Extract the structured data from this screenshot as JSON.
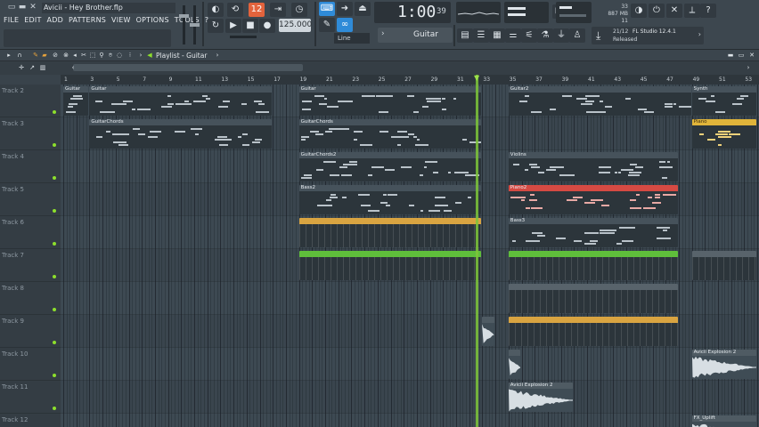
{
  "window": {
    "title": "Avicii - Hey Brother.flp",
    "buttons": [
      "▭",
      "▬",
      "✕"
    ]
  },
  "menu": [
    "FILE",
    "EDIT",
    "ADD",
    "PATTERNS",
    "VIEW",
    "OPTIONS",
    "TOOLS",
    "?"
  ],
  "transport": {
    "pattern_number": "12",
    "bpm": "125.000",
    "time_main": "1:00",
    "time_sub": "39",
    "snap": "Line",
    "pattern_name": "Guitar"
  },
  "cpu": {
    "value": "33",
    "memory": "887 MB",
    "polyphony": "11"
  },
  "news": {
    "date": "21/12",
    "title": "FL Studio 12.4.1",
    "status": "Released"
  },
  "playlist": {
    "title": "Playlist - Guitar",
    "breadcrumb_arrow": "›"
  },
  "ruler": {
    "bars": [
      "1",
      "3",
      "5",
      "7",
      "9",
      "11",
      "13",
      "15",
      "17",
      "19",
      "21",
      "23",
      "25",
      "27",
      "29",
      "31",
      "33",
      "35",
      "37",
      "39",
      "41",
      "43",
      "45",
      "47",
      "49",
      "51",
      "53"
    ]
  },
  "tracks": [
    {
      "name": "Track 2"
    },
    {
      "name": "Track 3"
    },
    {
      "name": "Track 4"
    },
    {
      "name": "Track 5"
    },
    {
      "name": "Track 6"
    },
    {
      "name": "Track 7"
    },
    {
      "name": "Track 8"
    },
    {
      "name": "Track 9"
    },
    {
      "name": "Track 10"
    },
    {
      "name": "Track 11"
    },
    {
      "name": "Track 12"
    }
  ],
  "playhead_bar": 32.5,
  "clips": [
    {
      "track": 0,
      "start": 1,
      "len": 2,
      "name": "Guitar",
      "kind": "pat"
    },
    {
      "track": 0,
      "start": 3,
      "len": 14,
      "name": "Guitar",
      "kind": "pat"
    },
    {
      "track": 0,
      "start": 19,
      "len": 14,
      "name": "Guitar",
      "kind": "pat"
    },
    {
      "track": 0,
      "start": 35,
      "len": 14,
      "name": "Guitar2",
      "kind": "pat"
    },
    {
      "track": 0,
      "start": 49,
      "len": 5,
      "name": "Synth",
      "kind": "pat"
    },
    {
      "track": 1,
      "start": 3,
      "len": 14,
      "name": "GuitarChords",
      "kind": "pat"
    },
    {
      "track": 1,
      "start": 19,
      "len": 14,
      "name": "GuitarChords",
      "kind": "pat"
    },
    {
      "track": 1,
      "start": 49,
      "len": 5,
      "name": "Piano",
      "kind": "yellow"
    },
    {
      "track": 2,
      "start": 19,
      "len": 14,
      "name": "GuitarChords2",
      "kind": "pat"
    },
    {
      "track": 2,
      "start": 35,
      "len": 13,
      "name": "Violins",
      "kind": "pat"
    },
    {
      "track": 3,
      "start": 19,
      "len": 14,
      "name": "Bass2",
      "kind": "pat"
    },
    {
      "track": 3,
      "start": 35,
      "len": 13,
      "name": "Piano2",
      "kind": "red"
    },
    {
      "track": 4,
      "start": 19,
      "len": 14,
      "name": "",
      "kind": "orange"
    },
    {
      "track": 4,
      "start": 35,
      "len": 13,
      "name": "Bass3",
      "kind": "pat"
    },
    {
      "track": 5,
      "start": 19,
      "len": 14,
      "name": "",
      "kind": "green"
    },
    {
      "track": 5,
      "start": 35,
      "len": 13,
      "name": "",
      "kind": "green"
    },
    {
      "track": 5,
      "start": 49,
      "len": 5,
      "name": "",
      "kind": "gray"
    },
    {
      "track": 6,
      "start": 35,
      "len": 13,
      "name": "",
      "kind": "gray"
    },
    {
      "track": 7,
      "start": 33,
      "len": 1,
      "name": "",
      "kind": "audio"
    },
    {
      "track": 7,
      "start": 35,
      "len": 13,
      "name": "",
      "kind": "orange"
    },
    {
      "track": 8,
      "start": 35,
      "len": 1,
      "name": "",
      "kind": "audio"
    },
    {
      "track": 8,
      "start": 49,
      "len": 5,
      "name": "Avicii Explosion 2",
      "kind": "audio"
    },
    {
      "track": 9,
      "start": 35,
      "len": 5,
      "name": "Avicii Explosion 2",
      "kind": "audio"
    },
    {
      "track": 10,
      "start": 49,
      "len": 5,
      "name": "FX_Uplift",
      "kind": "audio"
    }
  ],
  "colors": {
    "accent_orange": "#e3633c",
    "accent_blue": "#2f8bd8",
    "playhead": "#7ec63a",
    "clip_red": "#d54a43",
    "clip_green": "#5fbe3b",
    "clip_orange": "#d9a441"
  }
}
